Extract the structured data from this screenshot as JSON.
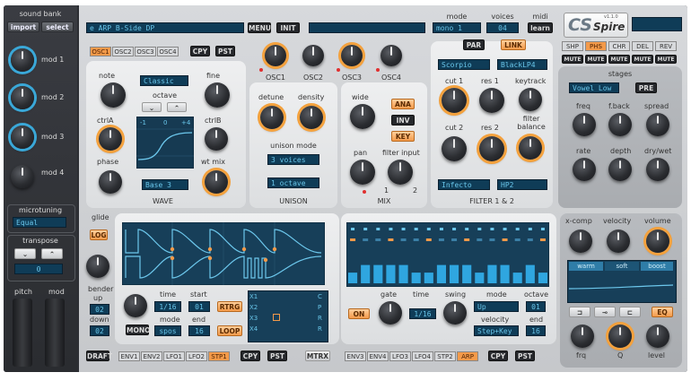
{
  "left": {
    "soundbank_label": "sound bank",
    "import_label": "import",
    "select_label": "select",
    "mods": [
      "mod 1",
      "mod 2",
      "mod 3",
      "mod 4"
    ],
    "microtuning_label": "microtuning",
    "microtuning_value": "Equal",
    "transpose_label": "transpose",
    "transpose_value": "0",
    "pitch_label": "pitch",
    "mod_label": "mod"
  },
  "header": {
    "preset_name": "e ARP B-Side DP",
    "menu_label": "MENU",
    "init_label": "INIT",
    "mode_label": "mode",
    "mode_value": "mono 1",
    "voices_label": "voices",
    "voices_value": "04",
    "midi_label": "midi",
    "learn_label": "learn",
    "logo": "Spire",
    "version": "v1.1.0"
  },
  "osc": {
    "tabs": [
      "OSC1",
      "OSC2",
      "OSC3",
      "OSC4"
    ],
    "cpy": "CPY",
    "pst": "PST",
    "level_labels": [
      "OSC1",
      "OSC2",
      "OSC3",
      "OSC4"
    ],
    "note": "note",
    "fine": "fine",
    "octave": "octave",
    "wave_type": "Classic",
    "ctrla": "ctrlA",
    "ctrlb": "ctrlB",
    "phase": "phase",
    "wtmix": "wt mix",
    "wave_mode": "Base 3",
    "section": "WAVE",
    "scope_labels": [
      "-1",
      "0",
      "+4"
    ]
  },
  "unison": {
    "detune": "detune",
    "density": "density",
    "mode_label": "unison mode",
    "voices": "3 voices",
    "octave": "1 octave",
    "section": "UNISON"
  },
  "mix": {
    "wide": "wide",
    "ana": "ANA",
    "inv": "INV",
    "key": "KEY",
    "pan": "pan",
    "filter_input": "filter input",
    "n1": "1",
    "n2": "2",
    "section": "MIX"
  },
  "filter": {
    "par": "PAR",
    "link": "LINK",
    "type1": "Scorpio",
    "type2": "BlackLP4",
    "cut1": "cut 1",
    "res1": "res 1",
    "keytrack": "keytrack",
    "cut2": "cut 2",
    "res2": "res 2",
    "balance": "filter balance",
    "mode1": "Infecto",
    "mode2": "HP2",
    "section": "FILTER 1 & 2"
  },
  "fx": {
    "tabs": [
      "SHP",
      "PHS",
      "CHR",
      "DEL",
      "REV"
    ],
    "mute": "MUTE",
    "stages_label": "stages",
    "stages_value": "Vowel Low",
    "pre": "PRE",
    "knobs": [
      "freq",
      "f.back",
      "spread",
      "rate",
      "depth",
      "dry/wet"
    ]
  },
  "glide": {
    "label": "glide",
    "log": "LOG",
    "bender": "bender",
    "up": "up",
    "up_value": "02",
    "down": "down",
    "down_value": "02"
  },
  "step": {
    "time": "time",
    "time_value": "1/16",
    "start": "start",
    "start_value": "01",
    "rtrg": "RTRG",
    "mono": "MONO",
    "mode": "mode",
    "mode_value": "spos",
    "end": "end",
    "end_value": "16",
    "loop": "LOOP",
    "xs": [
      "X1",
      "X2",
      "X3",
      "X4"
    ],
    "cprr": [
      "C",
      "P",
      "R",
      "R"
    ],
    "tabs": [
      "ENV1",
      "ENV2",
      "LFO1",
      "LFO2",
      "STP1"
    ],
    "cpy": "CPY",
    "pst": "PST",
    "mtrx": "MTRX",
    "draft": "DRAFT"
  },
  "arp": {
    "on": "ON",
    "gate": "gate",
    "time": "time",
    "time_value": "1/16",
    "swing": "swing",
    "mode": "mode",
    "mode_value": "Up",
    "octave": "octave",
    "octave_value": "01",
    "velocity": "velocity",
    "velocity_value": "Step+Key",
    "end": "end",
    "end_value": "16",
    "tabs": [
      "ENV3",
      "ENV4",
      "LFO3",
      "LFO4",
      "STP2",
      "ARP"
    ],
    "cpy": "CPY",
    "pst": "PST",
    "bars": [
      0.35,
      0.6,
      0.6,
      0.6,
      0.6,
      0.35,
      0.35,
      0.6,
      0.6,
      0.6,
      0.35,
      0.6,
      0.6,
      0.35,
      0.6,
      0.35
    ]
  },
  "eq": {
    "xcomp": "x-comp",
    "velocity": "velocity",
    "volume": "volume",
    "warm": "warm",
    "soft": "soft",
    "boost": "boost",
    "eq": "EQ",
    "frq": "frq",
    "q": "Q",
    "level": "level"
  }
}
